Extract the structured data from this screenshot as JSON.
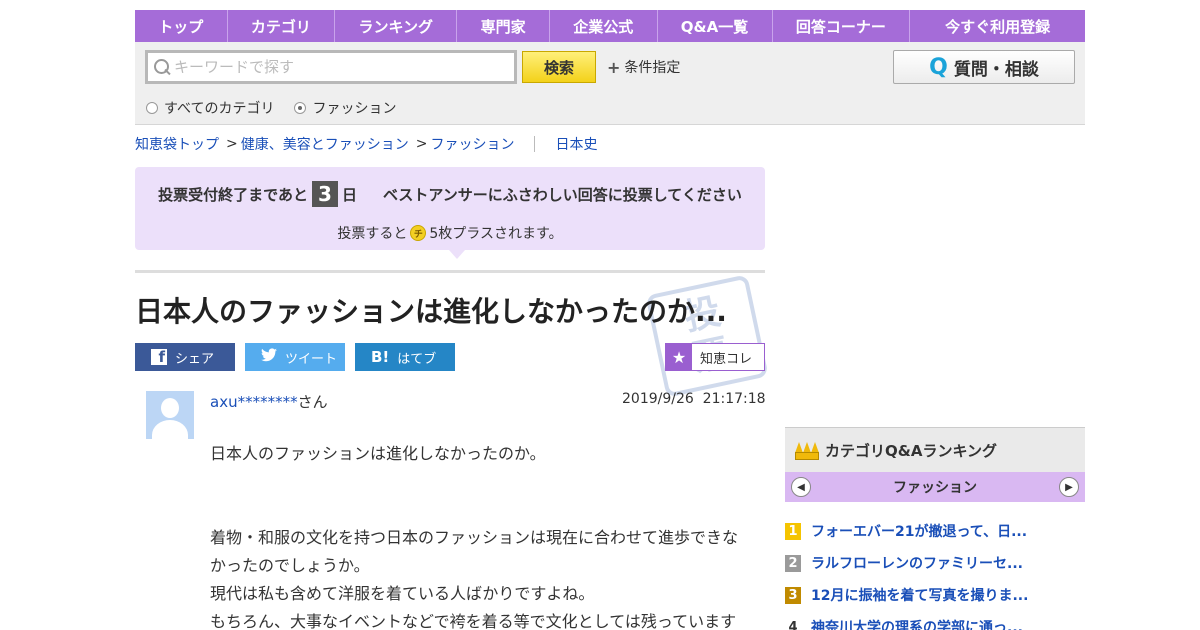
{
  "nav": {
    "items": [
      "トップ",
      "カテゴリ",
      "ランキング",
      "専門家",
      "企業公式",
      "Q&A一覧",
      "回答コーナー",
      "今すぐ利用登録"
    ]
  },
  "search": {
    "placeholder": "キーワードで探す",
    "button": "検索",
    "conditions": "条件指定",
    "ask_button": "質問・相談",
    "ask_icon_letter": "Q",
    "scope_all": "すべてのカテゴリ",
    "scope_category": "ファッション",
    "scope_selected": "ファッション"
  },
  "breadcrumb": {
    "items": [
      "知恵袋トップ",
      "健康、美容とファッション",
      "ファッション"
    ],
    "separator": ">",
    "tag": "日本史"
  },
  "vote": {
    "prefix": "投票受付終了まであと",
    "days": "3",
    "suffix": "日",
    "message": "ベストアンサーにふさわしい回答に投票してください",
    "note_prefix": "投票すると",
    "coin_label": "チ",
    "note_suffix": "5枚プラスされます。"
  },
  "question": {
    "title": "日本人のファッションは進化しなかったのか...",
    "stamp": [
      "投",
      "票"
    ],
    "user_id": "axu********",
    "user_suffix": "さん",
    "date": "2019/9/26  21:17:18",
    "body": [
      "日本人のファッションは進化しなかったのか。",
      "",
      "着物・和服の文化を持つ日本のファッションは現在に合わせて進歩できなかったのでしょうか。",
      "現代は私も含めて洋服を着ている人ばかりですよね。",
      "もちろん、大事なイベントなどで袴を着る等で文化としては残っています"
    ]
  },
  "share": {
    "facebook": "シェア",
    "facebook_icon": "f",
    "twitter": "ツイート",
    "hatena": "はてブ",
    "hatena_icon": "B!",
    "collect": "知恵コレ"
  },
  "ranking": {
    "title": "カテゴリQ&Aランキング",
    "category": "ファッション",
    "items": [
      {
        "rank": "1",
        "text": "フォーエバー21が撤退って、日...",
        "badge_color": "#f5c400"
      },
      {
        "rank": "2",
        "text": "ラルフローレンのファミリーセ...",
        "badge_color": "#9a9a9a"
      },
      {
        "rank": "3",
        "text": "12月に振袖を着て写真を撮りま...",
        "badge_color": "#c08a00"
      },
      {
        "rank": "4",
        "text": "神奈川大学の理系の学部に通っ...",
        "badge_color": ""
      }
    ]
  },
  "colors": {
    "nav_purple": "#a56cd8",
    "vote_bg": "#ece0fa",
    "link_blue": "#1a4fb8",
    "facebook": "#3b5998",
    "twitter": "#55acee",
    "hatena": "#2586c6"
  }
}
